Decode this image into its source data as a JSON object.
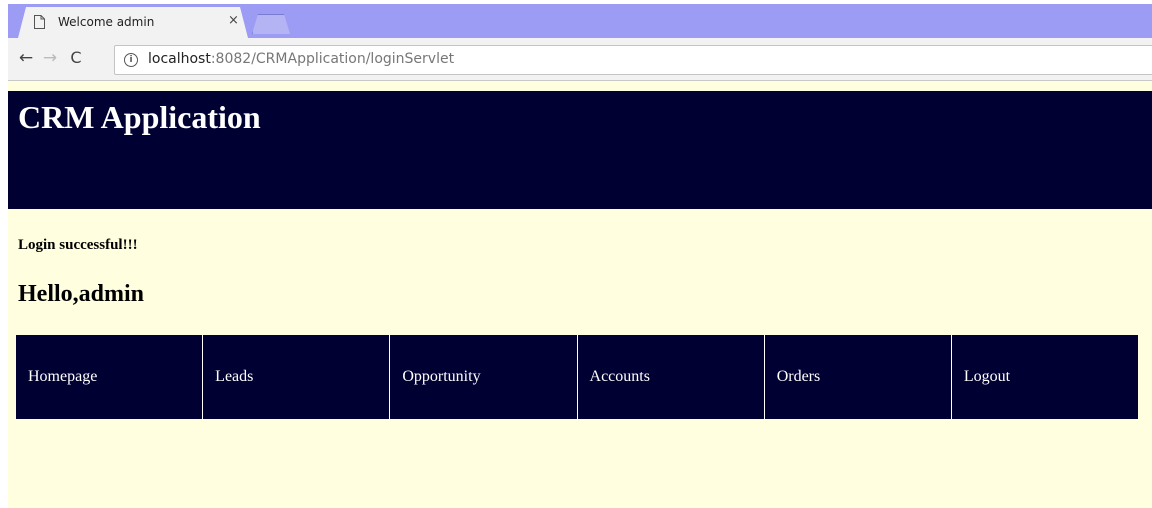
{
  "browser": {
    "tab": {
      "title": "Welcome admin",
      "close_glyph": "×"
    },
    "address": {
      "host": "localhost",
      "rest": ":8082/CRMApplication/loginServlet"
    },
    "icons": {
      "back": "←",
      "forward": "→",
      "reload": "C",
      "info": "i"
    }
  },
  "page": {
    "banner_title": "CRM Application",
    "login_message": "Login successful!!!",
    "greeting": "Hello,admin",
    "menu": [
      {
        "label": "Homepage"
      },
      {
        "label": "Leads"
      },
      {
        "label": "Opportunity"
      },
      {
        "label": "Accounts"
      },
      {
        "label": "Orders"
      },
      {
        "label": "Logout"
      }
    ]
  },
  "colors": {
    "banner_bg": "#000033",
    "page_bg": "#ffffe0",
    "tabstrip_bg": "#9c9cf5"
  }
}
